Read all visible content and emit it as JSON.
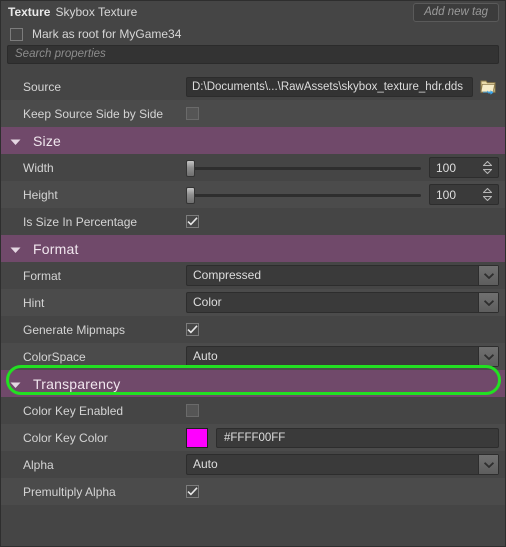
{
  "header": {
    "type_label": "Texture",
    "asset_name": "Skybox Texture",
    "add_tag_button": "Add new tag",
    "mark_as_root_label": "Mark as root for MyGame34",
    "mark_as_root_checked": false,
    "search_placeholder": "Search properties"
  },
  "top_properties": [
    {
      "name": "Source",
      "kind": "path",
      "value": "D:\\Documents\\...\\RawAssets\\skybox_texture_hdr.dds",
      "browse_icon": "folder-open-icon"
    },
    {
      "name": "Keep Source Side by Side",
      "kind": "checkbox",
      "checked": false
    }
  ],
  "sections": [
    {
      "title": "Size",
      "expanded": true,
      "caret_icon": "chevron-down-icon",
      "rows": [
        {
          "name": "Width",
          "kind": "slider",
          "value": "100",
          "slider_pct": 0
        },
        {
          "name": "Height",
          "kind": "slider",
          "value": "100",
          "slider_pct": 0
        },
        {
          "name": "Is Size In Percentage",
          "kind": "checkbox",
          "checked": true
        }
      ]
    },
    {
      "title": "Format",
      "expanded": true,
      "caret_icon": "chevron-down-icon",
      "rows": [
        {
          "name": "Format",
          "kind": "combo",
          "value": "Compressed"
        },
        {
          "name": "Hint",
          "kind": "combo",
          "value": "Color"
        },
        {
          "name": "Generate Mipmaps",
          "kind": "checkbox",
          "checked": true
        },
        {
          "name": "ColorSpace",
          "kind": "combo",
          "value": "Auto",
          "highlighted": true
        }
      ]
    },
    {
      "title": "Transparency",
      "expanded": true,
      "caret_icon": "chevron-down-icon",
      "rows": [
        {
          "name": "Color Key Enabled",
          "kind": "checkbox",
          "checked": false
        },
        {
          "name": "Color Key Color",
          "kind": "color",
          "value": "#FFFF00FF",
          "swatch_color": "#FF00FF"
        },
        {
          "name": "Alpha",
          "kind": "combo",
          "value": "Auto"
        },
        {
          "name": "Premultiply Alpha",
          "kind": "checkbox",
          "checked": true
        }
      ]
    }
  ],
  "colors": {
    "panel_bg": "#454545",
    "row_alt_bg": "#4b4b4b",
    "section_header_bg": "#70496a",
    "highlight_ring": "#22E022",
    "input_bg": "#333333"
  }
}
